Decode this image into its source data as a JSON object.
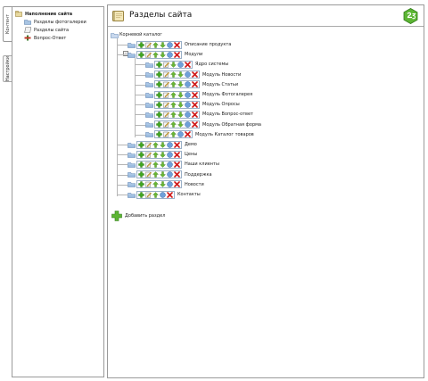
{
  "tabs": [
    {
      "label": "Контент",
      "active": true
    },
    {
      "label": "Настройки",
      "active": false
    }
  ],
  "left_tree": {
    "root": "Наполнение сайта",
    "items": [
      "Разделы фотогалереи",
      "Разделы сайта",
      "Вопрос-Ответ"
    ]
  },
  "header": {
    "title": "Разделы сайта"
  },
  "tree": {
    "root_label": "Корневой каталог",
    "add_section": "Добавить раздел"
  },
  "rows": [
    {
      "label": "Описание продукта",
      "level": 1,
      "icons": [
        "add",
        "edit",
        "up",
        "down",
        "info",
        "del"
      ]
    },
    {
      "label": "Модули",
      "level": 1,
      "icons": [
        "add",
        "edit",
        "up",
        "down",
        "info",
        "del"
      ]
    },
    {
      "label": "Ядро системы",
      "level": 2,
      "icons": [
        "add",
        "edit",
        "down",
        "info",
        "del"
      ]
    },
    {
      "label": "Модуль Новости",
      "level": 2,
      "icons": [
        "add",
        "edit",
        "up",
        "down",
        "info",
        "del"
      ]
    },
    {
      "label": "Модуль Статьи",
      "level": 2,
      "icons": [
        "add",
        "edit",
        "up",
        "down",
        "info",
        "del"
      ]
    },
    {
      "label": "Модуль Фотогалерея",
      "level": 2,
      "icons": [
        "add",
        "edit",
        "up",
        "down",
        "info",
        "del"
      ]
    },
    {
      "label": "Модуль Опросы",
      "level": 2,
      "icons": [
        "add",
        "edit",
        "up",
        "down",
        "info",
        "del"
      ]
    },
    {
      "label": "Модуль Вопрос-ответ",
      "level": 2,
      "icons": [
        "add",
        "edit",
        "up",
        "down",
        "info",
        "del"
      ]
    },
    {
      "label": "Модуль Обратная форма",
      "level": 2,
      "icons": [
        "add",
        "edit",
        "up",
        "down",
        "info",
        "del"
      ]
    },
    {
      "label": "Модуль Каталог товаров",
      "level": 2,
      "icons": [
        "add",
        "edit",
        "up",
        "info",
        "del"
      ]
    },
    {
      "label": "Демо",
      "level": 1,
      "icons": [
        "add",
        "edit",
        "up",
        "down",
        "info",
        "del"
      ]
    },
    {
      "label": "Цены",
      "level": 1,
      "icons": [
        "add",
        "edit",
        "up",
        "down",
        "info",
        "del"
      ]
    },
    {
      "label": "Наши клиенты",
      "level": 1,
      "icons": [
        "add",
        "edit",
        "up",
        "down",
        "info",
        "del"
      ]
    },
    {
      "label": "Поддержка",
      "level": 1,
      "icons": [
        "add",
        "edit",
        "up",
        "down",
        "info",
        "del"
      ]
    },
    {
      "label": "Новости",
      "level": 1,
      "icons": [
        "add",
        "edit",
        "up",
        "down",
        "info",
        "del"
      ]
    },
    {
      "label": "Контакты",
      "level": 1,
      "icons": [
        "add",
        "edit",
        "up",
        "info",
        "del"
      ]
    }
  ],
  "colors": {
    "border": "#9a9a9a",
    "toolbar_border": "#9ab0c8",
    "add_green": "#3fa81f",
    "delete_red": "#d01818",
    "info_blue": "#4f86c8",
    "folder_blue": "#8ab0d8"
  }
}
